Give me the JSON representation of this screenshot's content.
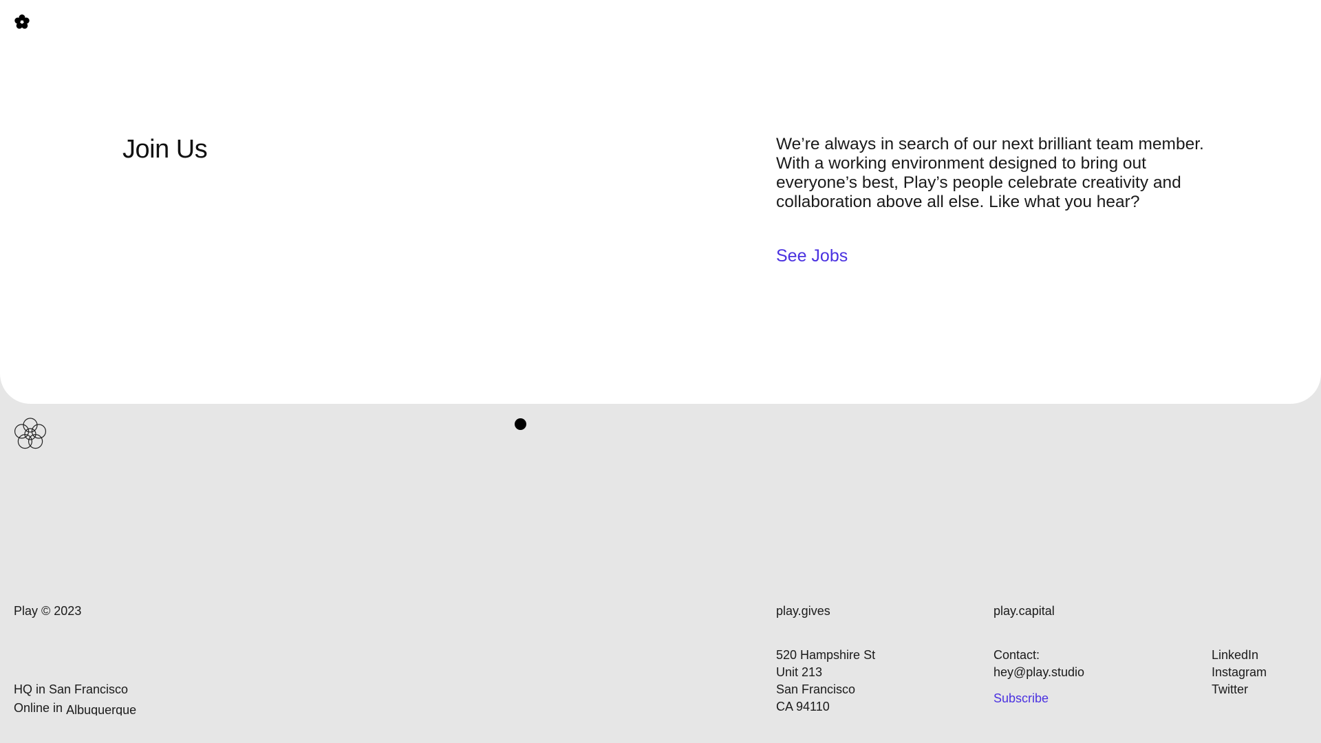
{
  "hero": {
    "title": "Join Us",
    "body": "We’re always in search of our next brilliant team member. With a working environment designed to bring out everyone’s best, Play’s people celebrate creativity and collaboration above all else. Like what you hear?",
    "cta_label": "See Jobs"
  },
  "footer": {
    "copyright": "Play © 2023",
    "links": {
      "gives": "play.gives",
      "capital": "play.capital"
    },
    "locations": {
      "hq": "HQ in San Francisco",
      "online_prefix": "Online in",
      "online_city": "Albuquerque"
    },
    "address": [
      "520 Hampshire St",
      "Unit 213",
      "San Francisco",
      "CA 94110"
    ],
    "contact": {
      "label": "Contact:",
      "email": "hey@play.studio",
      "subscribe": "Subscribe"
    },
    "social": [
      "LinkedIn",
      "Instagram",
      "Twitter"
    ]
  },
  "colors": {
    "accent": "#4a31e0",
    "panel": "#ffffff",
    "background": "#e6e6e6"
  },
  "icons": {
    "header_logo": "flower-icon",
    "footer_logo": "flower-outline-icon",
    "cursor": "cursor-dot"
  }
}
